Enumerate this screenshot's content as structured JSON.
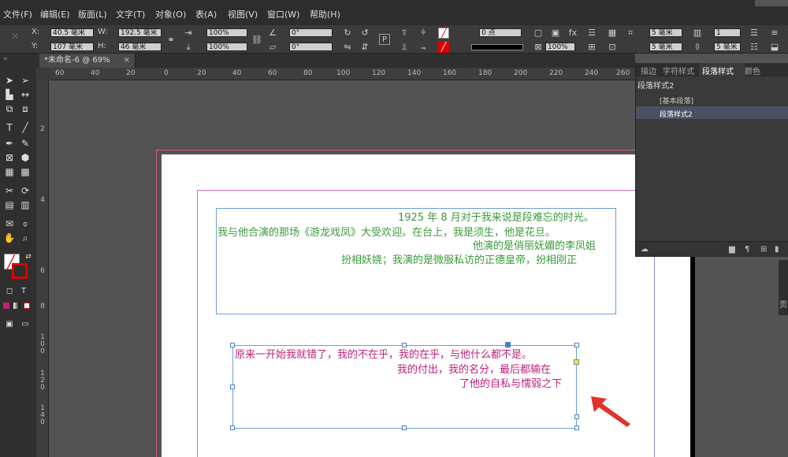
{
  "menu": {
    "file": "文件(F)",
    "edit": "编辑(E)",
    "layout": "版面(L)",
    "type": "文字(T)",
    "object": "对象(O)",
    "table": "表(A)",
    "view": "视图(V)",
    "window": "窗口(W)",
    "help": "帮助(H)"
  },
  "control": {
    "x_label": "X:",
    "x_value": "40.5 毫米",
    "y_label": "Y:",
    "y_value": "107 毫米",
    "w_label": "W:",
    "w_value": "192.5 毫米",
    "h_label": "H:",
    "h_value": "46 毫米",
    "scale_x": "100%",
    "scale_y": "100%",
    "rotate": "0°",
    "shear": "0°",
    "stroke_weight": "0 点",
    "opacity": "100%",
    "gap1": "5 毫米",
    "gap2": "5 毫米",
    "columns1": "1",
    "columns2": "5 毫米"
  },
  "tab": {
    "title": "*未命名-6 @ 69%",
    "close": "×"
  },
  "ruler": {
    "h_ticks": [
      "60",
      "40",
      "20",
      "0",
      "20",
      "40",
      "60",
      "80",
      "100",
      "120",
      "140",
      "160",
      "180",
      "200",
      "220",
      "240",
      "260"
    ],
    "v_ticks": [
      "2",
      "4",
      "6",
      "8",
      "100",
      "120",
      "140"
    ]
  },
  "text_frame_1": {
    "lines": [
      "1925 年 8 月对于我来说是段难忘的时光。",
      "我与他合演的那场《游龙戏凤》大受欢迎。在台上，我是须生，他是花旦。",
      "他演的是俏丽妩媚的李凤姐",
      "扮相妖娆；我演的是微服私访的正德皇帝，扮相刚正"
    ],
    "color": "#3a9a3a"
  },
  "text_frame_2": {
    "lines": [
      "原来一开始我就错了，我的不在乎，我的在乎，与他什么都不是。",
      "我的付出，我的名分，最后都输在",
      "了他的自私与懦弱之下"
    ],
    "color": "#c1207a"
  },
  "panel": {
    "tabs": [
      "描边",
      "字符样式",
      "段落样式",
      "颜色"
    ],
    "active_tab": "段落样式",
    "current_style": "段落样式2",
    "items": [
      "[基本段落]",
      "段落样式2"
    ]
  },
  "side_strip_label": "页"
}
